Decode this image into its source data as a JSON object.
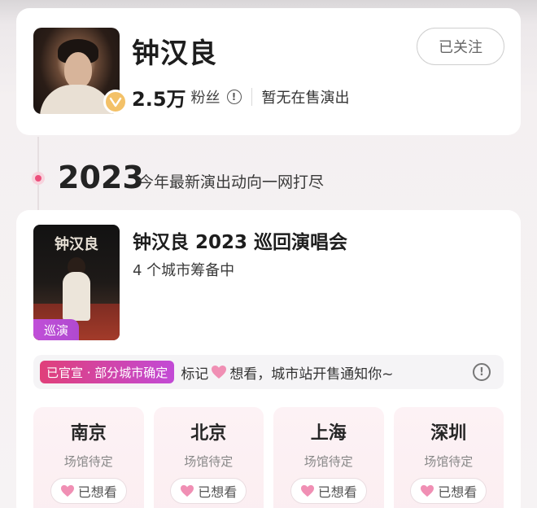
{
  "artist": {
    "name": "钟汉良",
    "follow_label": "已关注",
    "fans_count": "2.5万",
    "fans_label": "粉丝",
    "sale_status": "暂无在售演出"
  },
  "timeline": {
    "year": "2023",
    "caption": "今年最新演出动向一网打尽"
  },
  "concert": {
    "poster_title": "钟汉良",
    "tag": "巡演",
    "title": "钟汉良 2023 巡回演唱会",
    "subtitle": "4 个城市筹备中",
    "notice_tag": "已官宣 · 部分城市确定",
    "notice_prefix": "标记",
    "notice_suffix": "想看，城市站开售通知你~",
    "cities": [
      {
        "name": "南京",
        "venue": "场馆待定",
        "button": "已想看"
      },
      {
        "name": "北京",
        "venue": "场馆待定",
        "button": "已想看"
      },
      {
        "name": "上海",
        "venue": "场馆待定",
        "button": "已想看"
      },
      {
        "name": "深圳",
        "venue": "场馆待定",
        "button": "已想看"
      }
    ]
  },
  "colors": {
    "accent_pink": "#ec4f7c",
    "tag_purple": "#c04fd8",
    "verified_gold": "#f3c168"
  }
}
